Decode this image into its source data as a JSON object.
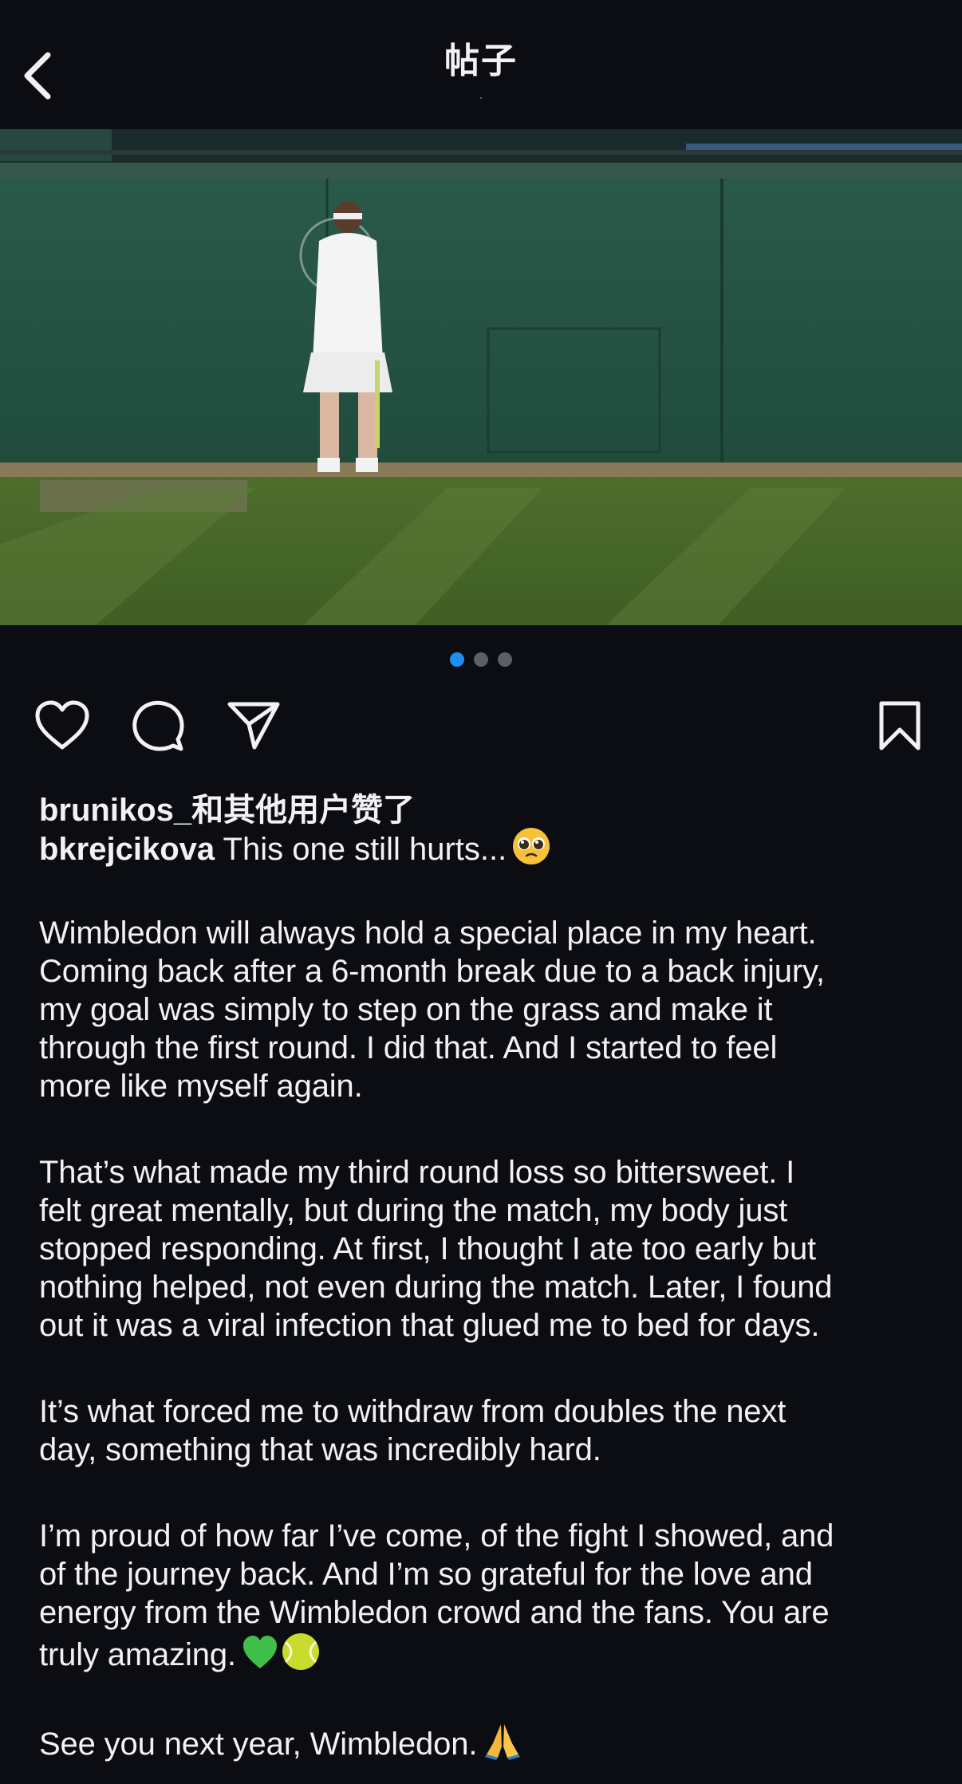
{
  "header": {
    "title": "帖子",
    "subtitle": "·"
  },
  "carousel": {
    "total": 3,
    "active_index": 0
  },
  "likes_text": "brunikos_和其他用户赞了",
  "post": {
    "author": "bkrejcikova",
    "first_line": " This one still hurts...",
    "paragraphs": [
      {
        "lines": [
          "Wimbledon will always hold a special place in my heart.",
          "Coming back after a 6-month break due to a back injury,",
          "my goal was simply to step on the grass and make it",
          "through the first round. I did that. And I started to feel",
          "more like myself again."
        ]
      },
      {
        "lines": [
          "That’s what made my third round loss so bittersweet. I",
          "felt great mentally, but during the match, my body just",
          "stopped responding. At first, I thought I ate too early but",
          "nothing helped, not even during the match. Later, I found",
          "out it was a viral infection that glued me to bed for days."
        ]
      },
      {
        "lines": [
          "It’s what forced me to withdraw from doubles the next",
          "day, something that was incredibly hard."
        ]
      },
      {
        "lines": [
          "I’m proud of how far I’ve come, of the fight I showed, and",
          "of the journey back. And I’m so grateful for the love and",
          "energy from the Wimbledon crowd and the fans. You are",
          "truly amazing."
        ]
      },
      {
        "lines": [
          "See you next year, Wimbledon."
        ]
      }
    ]
  },
  "colors": {
    "background": "#0b0d13",
    "text": "#f2f2f4",
    "accent_dot": "#1d8ff2"
  },
  "icons": {
    "back": "chevron-left-icon",
    "like": "heart-outline-icon",
    "comment": "comment-bubble-icon",
    "share": "paper-plane-icon",
    "save": "bookmark-icon"
  }
}
